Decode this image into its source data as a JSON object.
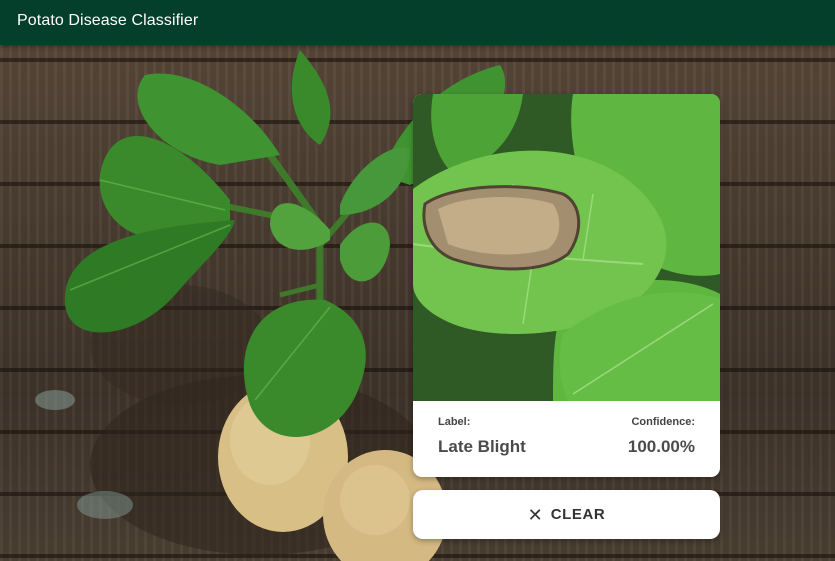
{
  "app_bar": {
    "title": "Potato Disease Classifier"
  },
  "result": {
    "label_caption": "Label:",
    "label_value": "Late Blight",
    "confidence_caption": "Confidence:",
    "confidence_value": "100.00%"
  },
  "actions": {
    "clear_label": "CLEAR",
    "clear_icon": "close-icon"
  },
  "colors": {
    "app_bar": "#033f2a",
    "card": "#ffffff",
    "text": "#4b4b4b",
    "leaf": "#6fc24a",
    "wood": "#4a3d31"
  }
}
